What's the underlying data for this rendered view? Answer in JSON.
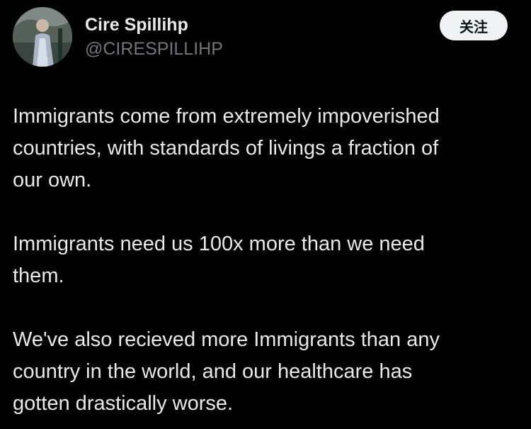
{
  "author": {
    "display_name": "Cire Spillihp",
    "handle": "@CIRESPILLIHP"
  },
  "follow_button_label": "关注",
  "post": {
    "paragraphs": [
      "Immigrants come from extremely impoverished\ncountries, with standards of livings a fraction of\nour own.",
      "Immigrants need us 100x more than we need\nthem.",
      "We've also recieved more Immigrants than any\ncountry in the world, and our healthcare has\ngotten drastically worse."
    ]
  },
  "colors": {
    "background": "#000000",
    "text_primary": "#e7e9ea",
    "text_secondary": "#71767b",
    "button_bg": "#eff3f4",
    "button_text": "#0f1419"
  }
}
